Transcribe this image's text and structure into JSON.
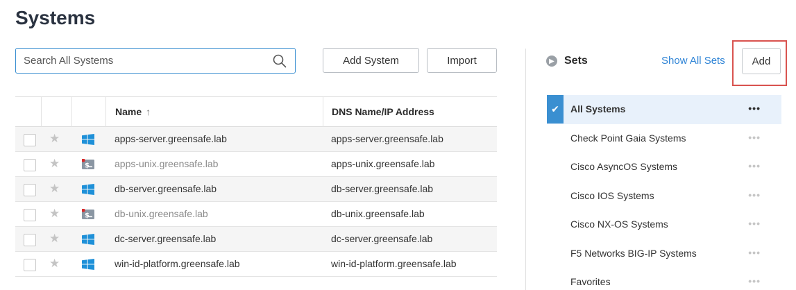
{
  "page": {
    "title": "Systems"
  },
  "search": {
    "placeholder": "Search All Systems",
    "value": ""
  },
  "toolbar": {
    "add_system_label": "Add System",
    "import_label": "Import"
  },
  "table": {
    "columns": {
      "name": "Name",
      "dns": "DNS Name/IP Address",
      "sort_indicator": "↑"
    },
    "rows": [
      {
        "name": "apps-server.greensafe.lab",
        "dns": "apps-server.greensafe.lab",
        "os": "windows",
        "muted": false
      },
      {
        "name": "apps-unix.greensafe.lab",
        "dns": "apps-unix.greensafe.lab",
        "os": "unix",
        "muted": true
      },
      {
        "name": "db-server.greensafe.lab",
        "dns": "db-server.greensafe.lab",
        "os": "windows",
        "muted": false
      },
      {
        "name": "db-unix.greensafe.lab",
        "dns": "db-unix.greensafe.lab",
        "os": "unix",
        "muted": true
      },
      {
        "name": "dc-server.greensafe.lab",
        "dns": "dc-server.greensafe.lab",
        "os": "windows",
        "muted": false
      },
      {
        "name": "win-id-platform.greensafe.lab",
        "dns": "win-id-platform.greensafe.lab",
        "os": "windows",
        "muted": false
      }
    ]
  },
  "sets": {
    "title": "Sets",
    "show_all_label": "Show All Sets",
    "add_label": "Add",
    "more_label": "•••",
    "items": [
      {
        "label": "All Systems",
        "selected": true
      },
      {
        "label": "Check Point Gaia Systems",
        "selected": false
      },
      {
        "label": "Cisco AsyncOS Systems",
        "selected": false
      },
      {
        "label": "Cisco IOS Systems",
        "selected": false
      },
      {
        "label": "Cisco NX-OS Systems",
        "selected": false
      },
      {
        "label": "F5 Networks BIG-IP Systems",
        "selected": false
      },
      {
        "label": "Favorites",
        "selected": false
      }
    ]
  },
  "colors": {
    "accent": "#3a8fd1",
    "link": "#2f84d6",
    "highlight": "#d9534f",
    "windows_icon": "#1e90d8",
    "unix_icon": "#8a96a3",
    "alert_dot": "#d92b2b"
  }
}
